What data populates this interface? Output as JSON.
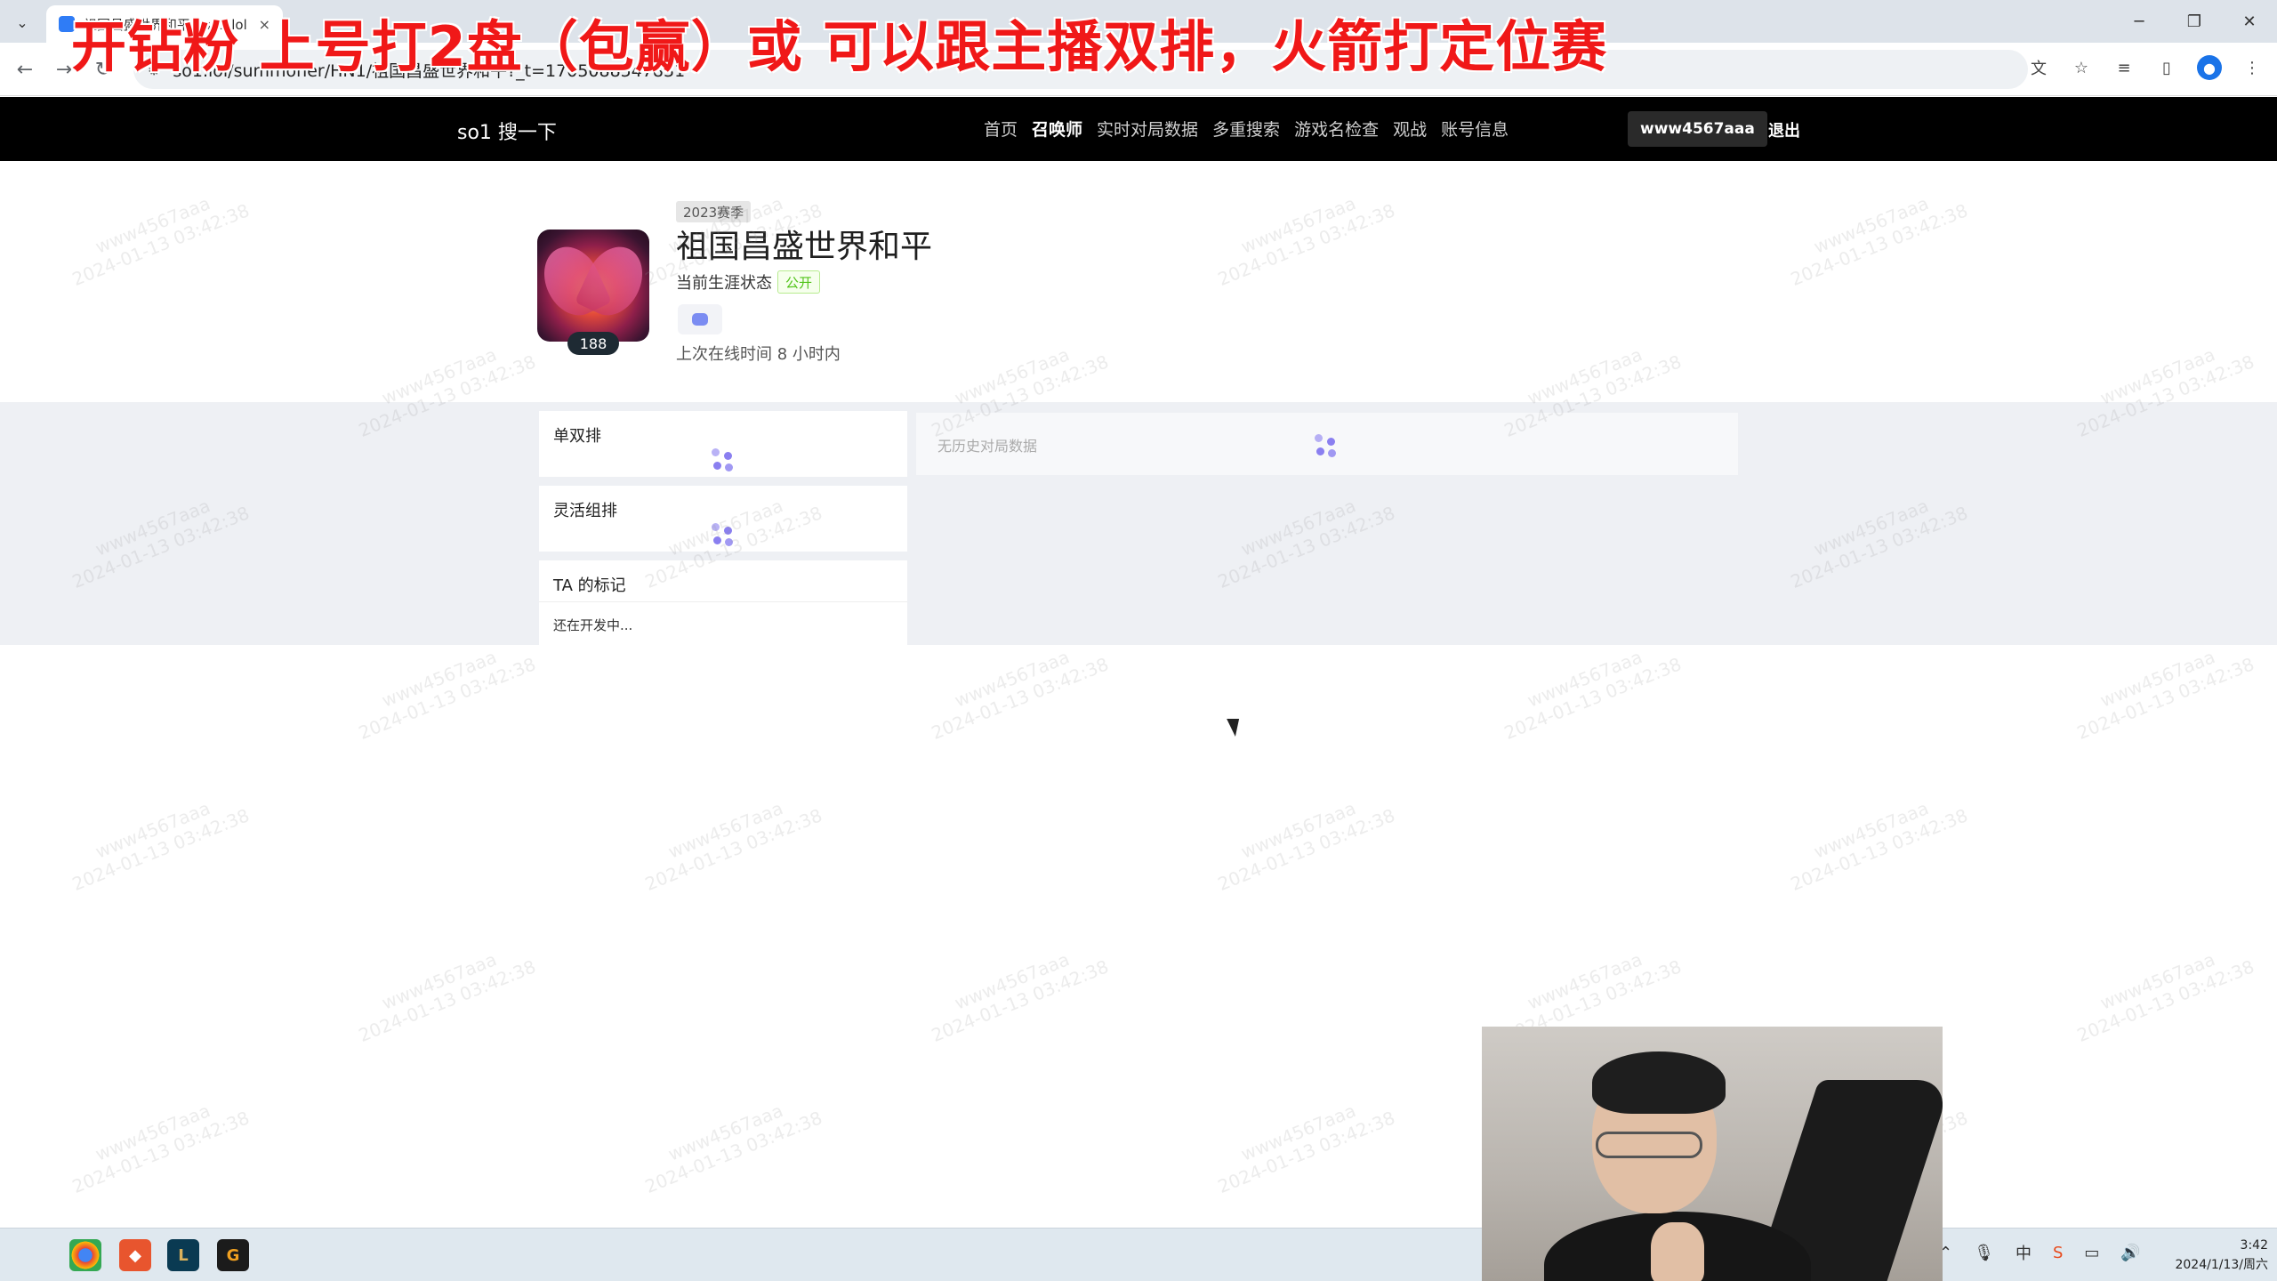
{
  "overlay": {
    "banner_text": "开钻粉 上号打2盘（包赢）或 可以跟主播双排，火箭打定位赛"
  },
  "browser": {
    "tab_title": "祖国昌盛世界和平 - so1.lol - 全",
    "url": "so1.lol/summoner/HN1/祖国昌盛世界和平?_t=1705088547831",
    "tab_menu_icon": "chevron-down-icon",
    "window_controls": [
      "─",
      "❐",
      "✕"
    ]
  },
  "site": {
    "brand": "so1 搜一下",
    "nav": [
      {
        "label": "首页",
        "active": false
      },
      {
        "label": "召唤师",
        "active": true
      },
      {
        "label": "实时对局数据",
        "active": false
      },
      {
        "label": "多重搜索",
        "active": false
      },
      {
        "label": "游戏名检查",
        "active": false
      },
      {
        "label": "观战",
        "active": false
      },
      {
        "label": "账号信息",
        "active": false
      }
    ],
    "user": "www4567aaa",
    "logout": "退出"
  },
  "profile": {
    "season": "2023赛季",
    "name": "祖国昌盛世界和平",
    "level": "188",
    "career_status_label": "当前生涯状态",
    "career_status_value": "公开",
    "last_online": "上次在线时间 8 小时内"
  },
  "cards": {
    "solo_duo": "单双排",
    "flex": "灵活组排",
    "tags_title": "TA 的标记",
    "tags_text": "还在开发中...",
    "history_empty": "无历史对局数据"
  },
  "watermark": {
    "line1": "www4567aaa",
    "line2": "2024-01-13 03:42:38"
  },
  "taskbar": {
    "time": "3:42",
    "date": "2024/1/13/周六"
  },
  "colors": {
    "banner": "#f01818",
    "header_bg": "#000000",
    "band_bg": "#eef0f4",
    "public_badge": "#52c41a",
    "spinner": "#8a7ff0"
  }
}
